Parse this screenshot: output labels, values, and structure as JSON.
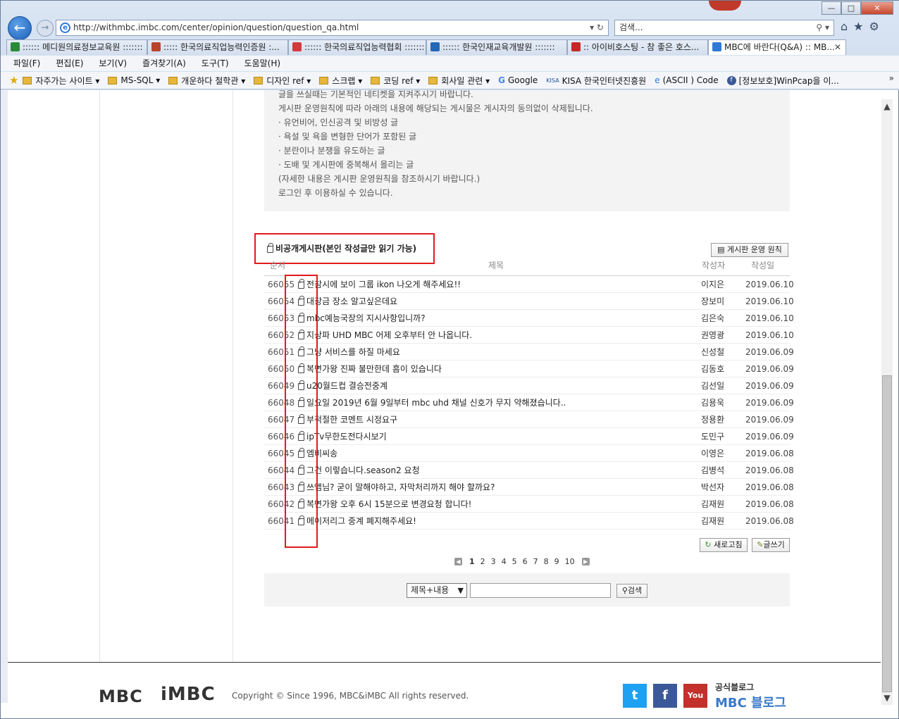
{
  "browser": {
    "url": "http://withmbc.imbc.com/center/opinion/question/question_qa.html",
    "search_placeholder": "검색...",
    "tabs": [
      {
        "label": ":::::: 메디원의료정보교육원 :::::::",
        "color": "#2a8a3a"
      },
      {
        "label": "::::: 한국의료직업능력인증원 :...",
        "color": "#b6452c"
      },
      {
        "label": ":::::: 한국의료직업능력협회 :::::::",
        "color": "#d23b3b"
      },
      {
        "label": ":::::: 한국인재교육개발원 :::::::",
        "color": "#2267b8"
      },
      {
        "label": ":: 아이비호스팅 - 참 좋은 호스...",
        "color": "#c82727"
      },
      {
        "label": "MBC에 바란다(Q&A) :: MB...",
        "color": "#2f7ad6"
      }
    ],
    "menu": [
      "파일(F)",
      "편집(E)",
      "보기(V)",
      "즐겨찾기(A)",
      "도구(T)",
      "도움말(H)"
    ],
    "favorites": [
      "자주가는 사이트 ▾",
      "MS-SQL ▾",
      "개운하다 철학관 ▾",
      "디자인 ref ▾",
      "스크랩 ▾",
      "코딩 ref ▾",
      "회사일 관련 ▾",
      "Google",
      "KISA 한국인터넷진흥원",
      "(ASCII ) Code",
      "[정보보호]WinPcap을 이..."
    ]
  },
  "rules": [
    "글을 쓰실때는 기본적인 네티켓을 지켜주시기 바랍니다.",
    "게시판 운영원칙에 따라 아래의 내용에 해당되는 게시물은 게시자의 동의없이 삭제됩니다.",
    "· 유언비어, 인신공격 및 비방성 글",
    "· 욕설 및 욕을 변형한 단어가 포함된 글",
    "· 분란이나 분쟁을 유도하는 글",
    "· 도배 및 게시판에 중복해서 올리는 글",
    "(자세한 내용은 게시판 운영원칙을 참조하시기 바랍니다.)",
    "로그인 후 이용하실 수 있습니다."
  ],
  "board": {
    "title": "비공개게시판(본인 작성글만 읽기 가능)",
    "op_rules_button": "게시판 운영 원칙",
    "headers": {
      "num": "순서",
      "title": "제목",
      "author": "작성자",
      "date": "작성일"
    },
    "rows": [
      {
        "num": "66055",
        "title": "전참시에 보이 그룹 ikon 나오게 해주세요!!",
        "author": "이지은",
        "date": "2019.06.10"
      },
      {
        "num": "66054",
        "title": "대장금 장소 알고싶은데요",
        "author": "장보미",
        "date": "2019.06.10"
      },
      {
        "num": "66053",
        "title": "mbc예능국장의 지시사항입니까?",
        "author": "김은숙",
        "date": "2019.06.10"
      },
      {
        "num": "66052",
        "title": "지상파 UHD MBC 어제 오후부터 안 나옵니다.",
        "author": "권영광",
        "date": "2019.06.10"
      },
      {
        "num": "66051",
        "title": "그냥 서비스를 하질 마세요",
        "author": "신성철",
        "date": "2019.06.09"
      },
      {
        "num": "66050",
        "title": "복면가왕 진짜 불만한데 흠이 있습니다",
        "author": "김동호",
        "date": "2019.06.09"
      },
      {
        "num": "66049",
        "title": "u20월드컵 결승전중계",
        "author": "김선일",
        "date": "2019.06.09"
      },
      {
        "num": "66048",
        "title": "일요일 2019년 6월 9일부터 mbc uhd 채널 신호가 무지 약해졌습니다..",
        "author": "김용욱",
        "date": "2019.06.09"
      },
      {
        "num": "66047",
        "title": "부적절한 코멘트 시정요구",
        "author": "정용환",
        "date": "2019.06.09"
      },
      {
        "num": "66046",
        "title": "ipTv무한도전다시보기",
        "author": "도민구",
        "date": "2019.06.09"
      },
      {
        "num": "66045",
        "title": "엠비씨송",
        "author": "이영은",
        "date": "2019.06.08"
      },
      {
        "num": "66044",
        "title": "그건 이렇습니다.season2 요청",
        "author": "김병석",
        "date": "2019.06.08"
      },
      {
        "num": "66043",
        "title": "쓰앰님? 굳이 말해야하고, 자막처리까지 해야 할까요?",
        "author": "박선자",
        "date": "2019.06.08"
      },
      {
        "num": "66042",
        "title": "복면가왕 오후 6시 15분으로 변경요청 합니다!",
        "author": "김재원",
        "date": "2019.06.08"
      },
      {
        "num": "66041",
        "title": "메이저리그 중계 폐지해주세요!",
        "author": "김재원",
        "date": "2019.06.08"
      }
    ],
    "refresh_button": "새로고침",
    "write_button": "글쓰기",
    "pages": [
      "1",
      "2",
      "3",
      "4",
      "5",
      "6",
      "7",
      "8",
      "9",
      "10"
    ],
    "search_select": "제목+내용",
    "search_button": "검색"
  },
  "footer": {
    "logo1": "MBC",
    "logo2": "iMBC",
    "copyright": "Copyright © Since 1996, MBC&iMBC All rights reserved.",
    "blog_title": "공식블로그",
    "blog_logo": "MBC 블로그"
  }
}
